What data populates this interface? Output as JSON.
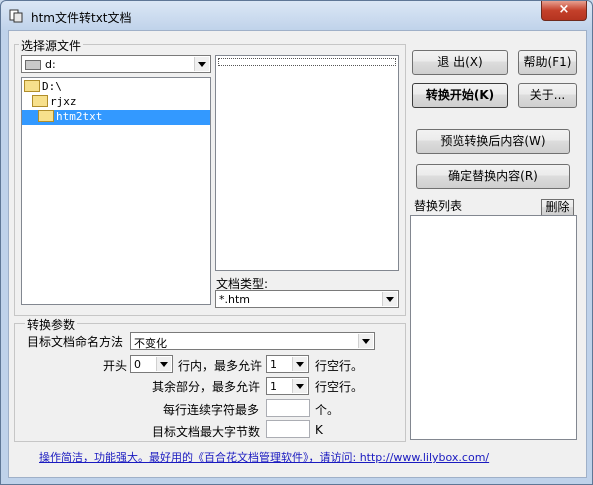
{
  "window": {
    "title": "htm文件转txt文档",
    "close_label": "×"
  },
  "source": {
    "group_label": "选择源文件",
    "drive_value": "d:",
    "tree": [
      "D:\\",
      "rjxz",
      "htm2txt"
    ],
    "filetype_label": "文档类型:",
    "filetype_value": "*.htm"
  },
  "buttons": {
    "exit": "退  出(X)",
    "help": "帮助(F1)",
    "start": "转换开始(K)",
    "about": "关于...",
    "preview": "预览转换后内容(W)",
    "confirm": "确定替换内容(R)",
    "delete": "删除"
  },
  "replace": {
    "label": "替换列表"
  },
  "params": {
    "group_label": "转换参数",
    "naming_label": "目标文档命名方法",
    "naming_value": "不变化",
    "head_label": "开头",
    "head_value": "0",
    "lines_in_label": "行内，最多允许",
    "lines_in_value": "1",
    "empty_line_label1": "行空行。",
    "rest_label": "其余部分，最多允许",
    "rest_value": "1",
    "empty_line_label2": "行空行。",
    "consecutive_label": "每行连续字符最多",
    "consecutive_unit": "个。",
    "maxbytes_label": "目标文档最大字节数",
    "maxbytes_unit": "K"
  },
  "footer": {
    "text": "操作简洁，功能强大。最好用的《百合花文档管理软件》，请访问: http://www.lilybox.com/"
  }
}
